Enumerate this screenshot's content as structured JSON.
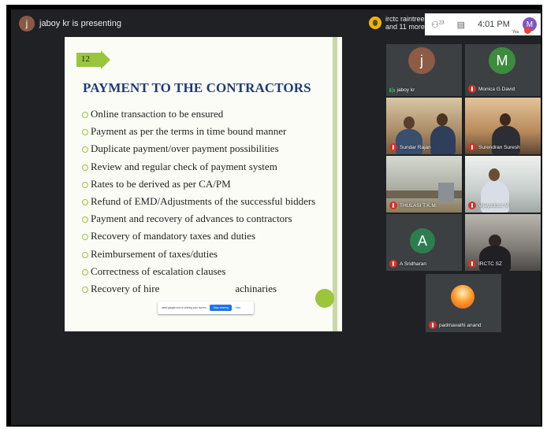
{
  "topbar": {
    "presenter_initial": "j",
    "presenter_text": "jaboy kr is presenting",
    "group_line1": "irctc raintree",
    "group_line2": "and 11 more",
    "people_count": "23",
    "time": "4:01 PM",
    "you_label": "You",
    "me_initial": "M"
  },
  "slide": {
    "number": "12",
    "title": "PAYMENT TO THE CONTRACTORS",
    "bullets": [
      "Online transaction to be ensured",
      "Payment as per the terms in time bound manner",
      "Duplicate payment/over payment possibilities",
      "Review and regular check of payment system",
      "Rates to be derived as per CA/PM",
      "Refund of EMD/Adjustments of the successful bidders",
      "Payment and recovery of advances to contractors",
      "Recovery of mandatory taxes and duties",
      "Reimbursement of taxes/duties",
      "Correctness of escalation clauses",
      "Recovery of hire"
    ],
    "last_bullet_tail": "achinaries"
  },
  "share_banner": {
    "text": "meet.google.com is sharing your screen.",
    "stop_label": "Stop sharing",
    "hide_label": "Hide"
  },
  "participants": [
    {
      "name": "jaboy kr",
      "initial": "j",
      "avatar_color": "#8d5b46"
    },
    {
      "name": "Monica G.David",
      "initial": "M",
      "avatar_color": "#3d8b3d"
    },
    {
      "name": "Sundar Rajan"
    },
    {
      "name": "Surendran Suresh"
    },
    {
      "name": "THULASI T.K.M."
    },
    {
      "name": "Vijayadoss M"
    },
    {
      "name": "A Sridharan",
      "initial": "A",
      "avatar_color": "#2e7d4f"
    },
    {
      "name": "IRCTC SZ"
    },
    {
      "name": "padmavathi anand"
    }
  ]
}
